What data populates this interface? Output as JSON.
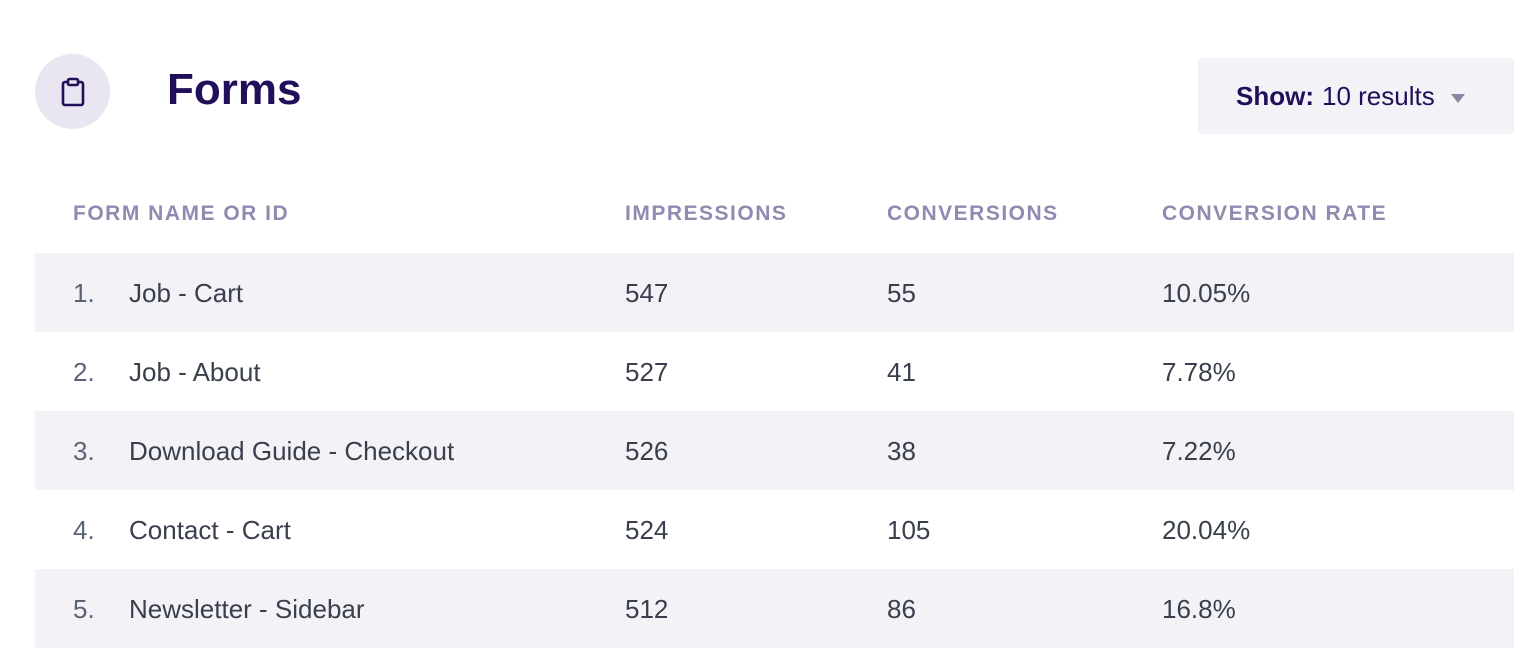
{
  "header": {
    "title": "Forms",
    "icon": "clipboard-icon"
  },
  "show": {
    "label": "Show:",
    "value": "10 results"
  },
  "table": {
    "columns": [
      "Form Name or ID",
      "Impressions",
      "Conversions",
      "Conversion Rate"
    ],
    "rows": [
      {
        "num": "1.",
        "name": "Job - Cart",
        "impressions": "547",
        "conversions": "55",
        "rate": "10.05%"
      },
      {
        "num": "2.",
        "name": "Job - About",
        "impressions": "527",
        "conversions": "41",
        "rate": "7.78%"
      },
      {
        "num": "3.",
        "name": "Download Guide - Checkout",
        "impressions": "526",
        "conversions": "38",
        "rate": "7.22%"
      },
      {
        "num": "4.",
        "name": "Contact - Cart",
        "impressions": "524",
        "conversions": "105",
        "rate": "20.04%"
      },
      {
        "num": "5.",
        "name": "Newsletter - Sidebar",
        "impressions": "512",
        "conversions": "86",
        "rate": "16.8%"
      }
    ]
  },
  "colors": {
    "title": "#210f59",
    "header_text": "#9389b0",
    "row_alt": "#f3f2f7",
    "icon_bg": "#e9e6f1"
  }
}
